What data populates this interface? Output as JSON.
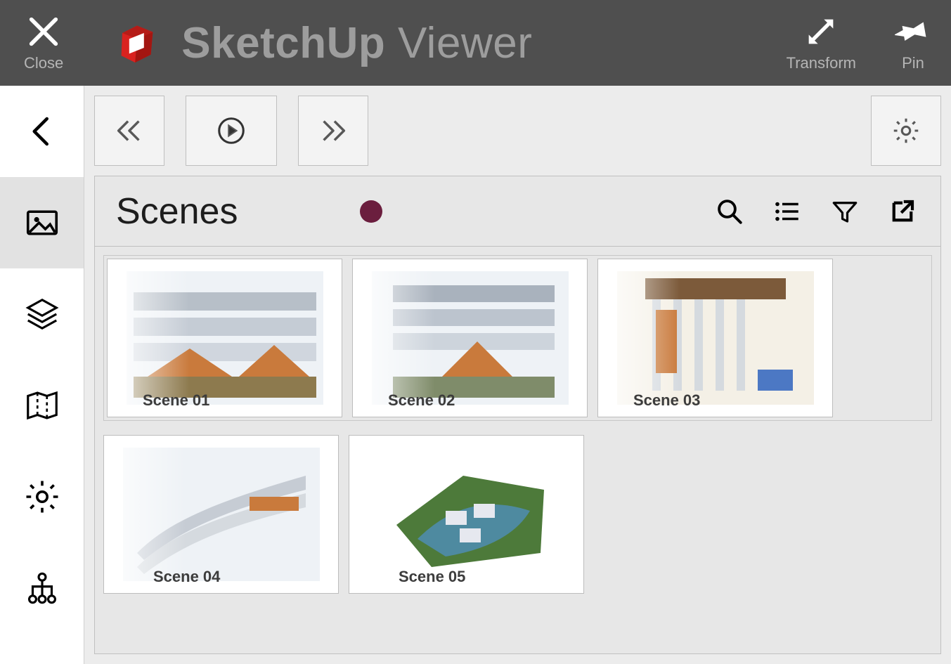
{
  "topbar": {
    "close_label": "Close",
    "app_name_bold": "SketchUp",
    "app_name_light": "Viewer",
    "transform_label": "Transform",
    "pin_label": "Pin"
  },
  "panel": {
    "title": "Scenes",
    "indicator_color": "#6b1e3e"
  },
  "scenes": [
    {
      "label": "Scene 01"
    },
    {
      "label": "Scene 02"
    },
    {
      "label": "Scene 03"
    },
    {
      "label": "Scene 04"
    },
    {
      "label": "Scene 05"
    }
  ]
}
